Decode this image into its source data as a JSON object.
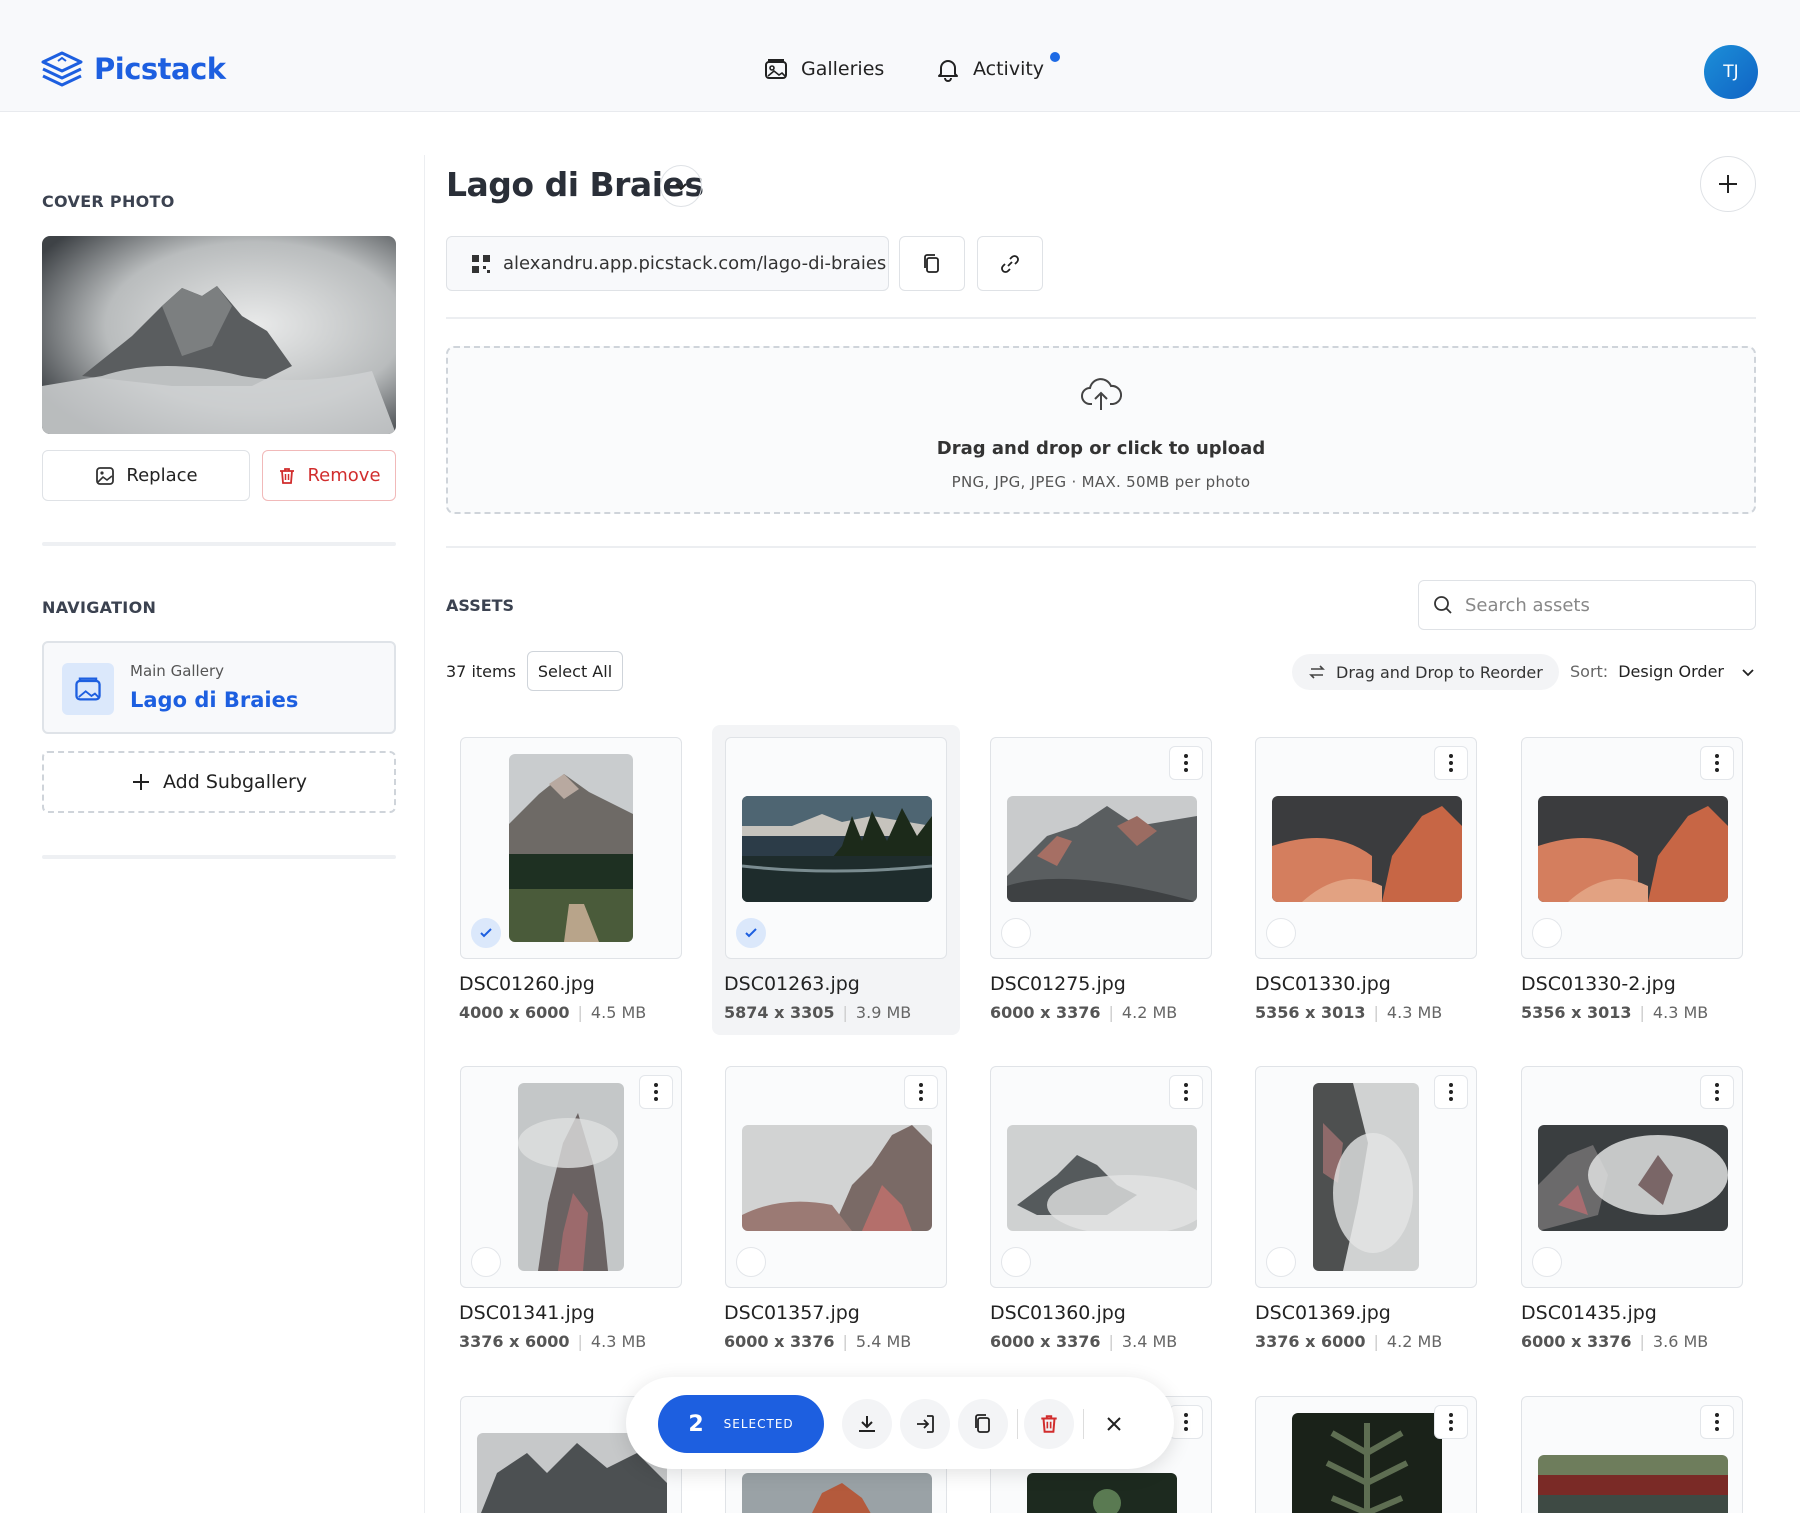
{
  "header": {
    "brand": "Picstack",
    "nav": [
      {
        "label": "Galleries",
        "icon": "gallery-icon"
      },
      {
        "label": "Activity",
        "icon": "bell-icon",
        "has_notification": true
      }
    ],
    "avatar_initials": "TJ"
  },
  "sidebar": {
    "cover_label": "COVER PHOTO",
    "replace_label": "Replace",
    "remove_label": "Remove",
    "navigation_label": "NAVIGATION",
    "nav_card": {
      "sub": "Main Gallery",
      "title": "Lago di Braies"
    },
    "add_subgallery_label": "Add Subgallery"
  },
  "main": {
    "title": "Lago di Braies",
    "url": "alexandru.app.picstack.com/lago-di-braies",
    "upload": {
      "title": "Drag and drop or click to upload",
      "hint": "PNG, JPG, JPEG · MAX. 50MB per photo"
    },
    "assets_label": "ASSETS",
    "search_placeholder": "Search assets",
    "count": "37 items",
    "select_all": "Select All",
    "reorder_label": "Drag and Drop to Reorder",
    "sort_label": "Sort:",
    "sort_value": "Design Order"
  },
  "assets": [
    {
      "name": "DSC01260.jpg",
      "dims": "4000 x 6000",
      "size": "4.5 MB",
      "selected": true
    },
    {
      "name": "DSC01263.jpg",
      "dims": "5874 x 3305",
      "size": "3.9 MB",
      "selected": true
    },
    {
      "name": "DSC01275.jpg",
      "dims": "6000 x 3376",
      "size": "4.2 MB",
      "selected": false
    },
    {
      "name": "DSC01330.jpg",
      "dims": "5356 x 3013",
      "size": "4.3 MB",
      "selected": false
    },
    {
      "name": "DSC01330-2.jpg",
      "dims": "5356 x 3013",
      "size": "4.3 MB",
      "selected": false
    },
    {
      "name": "DSC01341.jpg",
      "dims": "3376 x 6000",
      "size": "4.3 MB",
      "selected": false
    },
    {
      "name": "DSC01357.jpg",
      "dims": "6000 x 3376",
      "size": "5.4 MB",
      "selected": false
    },
    {
      "name": "DSC01360.jpg",
      "dims": "6000 x 3376",
      "size": "3.4 MB",
      "selected": false
    },
    {
      "name": "DSC01369.jpg",
      "dims": "3376 x 6000",
      "size": "4.2 MB",
      "selected": false
    },
    {
      "name": "DSC01435.jpg",
      "dims": "6000 x 3376",
      "size": "3.6 MB",
      "selected": false
    }
  ],
  "selection_bar": {
    "count": "2",
    "label": "SELECTED"
  },
  "colors": {
    "accent": "#1d5fe0",
    "danger": "#d12d2d"
  }
}
